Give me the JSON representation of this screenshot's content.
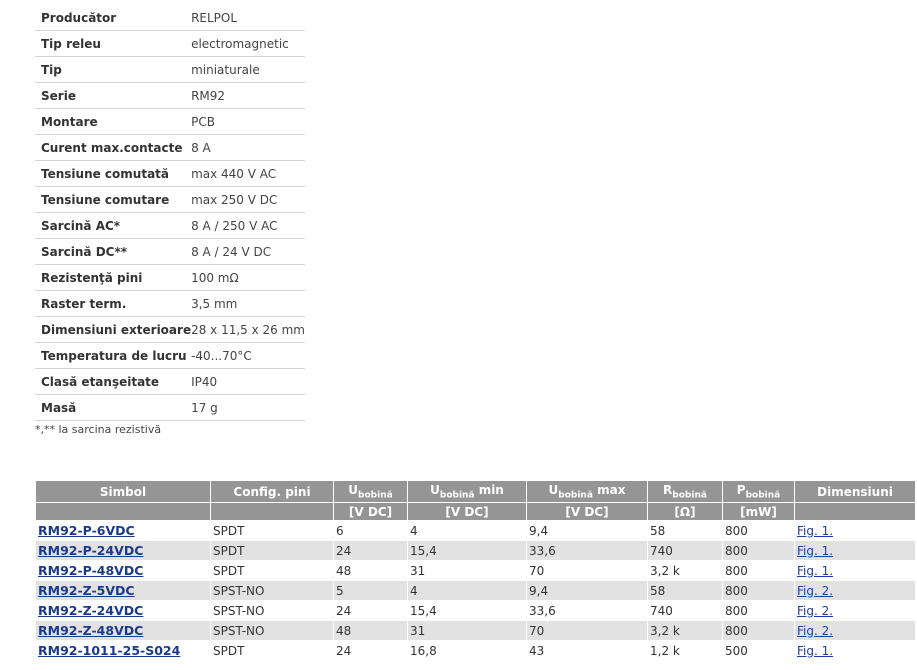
{
  "specs": [
    {
      "label": "Producător",
      "value": "RELPOL"
    },
    {
      "label": "Tip releu",
      "value": "electromagnetic"
    },
    {
      "label": "Tip",
      "value": "miniaturale"
    },
    {
      "label": "Serie",
      "value": "RM92"
    },
    {
      "label": "Montare",
      "value": "PCB"
    },
    {
      "label": "Curent max.contacte",
      "value": "8 A"
    },
    {
      "label": "Tensiune comutată",
      "value": "max 440 V AC"
    },
    {
      "label": "Tensiune comutare",
      "value": "max 250 V DC"
    },
    {
      "label": "Sarcină AC*",
      "value": "8 A / 250 V AC"
    },
    {
      "label": "Sarcină DC**",
      "value": "8 A / 24 V DC"
    },
    {
      "label": "Rezistenţă pini",
      "value": "100 mΩ"
    },
    {
      "label": "Raster term.",
      "value": "3,5 mm"
    },
    {
      "label": "Dimensiuni exterioare",
      "value": "28 x 11,5 x 26 mm"
    },
    {
      "label": "Temperatura de lucru",
      "value": "-40...70°C"
    },
    {
      "label": "Clasă etanşeitate",
      "value": "IP40"
    },
    {
      "label": "Masă",
      "value": "17 g"
    }
  ],
  "footnote": "*,** la sarcina rezistivă",
  "table": {
    "headers": {
      "symbol": "Simbol",
      "config": "Config. pini",
      "u_nom_main": "U",
      "u_nom_sub": "bobină",
      "u_min_main": "U",
      "u_min_sub": "bobină",
      "u_min_suffix": " min",
      "u_max_main": "U",
      "u_max_sub": "bobină",
      "u_max_suffix": " max",
      "r_main": "R",
      "r_sub": "bobină",
      "p_main": "P",
      "p_sub": "bobină",
      "dimensions": "Dimensiuni"
    },
    "units": [
      "[V DC]",
      "[V DC]",
      "[V DC]",
      "[Ω]",
      "[mW]"
    ],
    "rows": [
      {
        "symbol": "RM92-P-6VDC",
        "config": "SPDT",
        "u": "6",
        "umin": "4",
        "umax": "9,4",
        "r": "58",
        "p": "800",
        "fig": "Fig. 1."
      },
      {
        "symbol": "RM92-P-24VDC",
        "config": "SPDT",
        "u": "24",
        "umin": "15,4",
        "umax": "33,6",
        "r": "740",
        "p": "800",
        "fig": "Fig. 1."
      },
      {
        "symbol": "RM92-P-48VDC",
        "config": "SPDT",
        "u": "48",
        "umin": "31",
        "umax": "70",
        "r": "3,2 k",
        "p": "800",
        "fig": "Fig. 1."
      },
      {
        "symbol": "RM92-Z-5VDC",
        "config": "SPST-NO",
        "u": "5",
        "umin": "4",
        "umax": "9,4",
        "r": "58",
        "p": "800",
        "fig": "Fig. 2."
      },
      {
        "symbol": "RM92-Z-24VDC",
        "config": "SPST-NO",
        "u": "24",
        "umin": "15,4",
        "umax": "33,6",
        "r": "740",
        "p": "800",
        "fig": "Fig. 2."
      },
      {
        "symbol": "RM92-Z-48VDC",
        "config": "SPST-NO",
        "u": "48",
        "umin": "31",
        "umax": "70",
        "r": "3,2 k",
        "p": "800",
        "fig": "Fig. 2."
      },
      {
        "symbol": "RM92-1011-25-S024",
        "config": "SPDT",
        "u": "24",
        "umin": "16,8",
        "umax": "43",
        "r": "1,2 k",
        "p": "500",
        "fig": "Fig. 1."
      }
    ]
  }
}
